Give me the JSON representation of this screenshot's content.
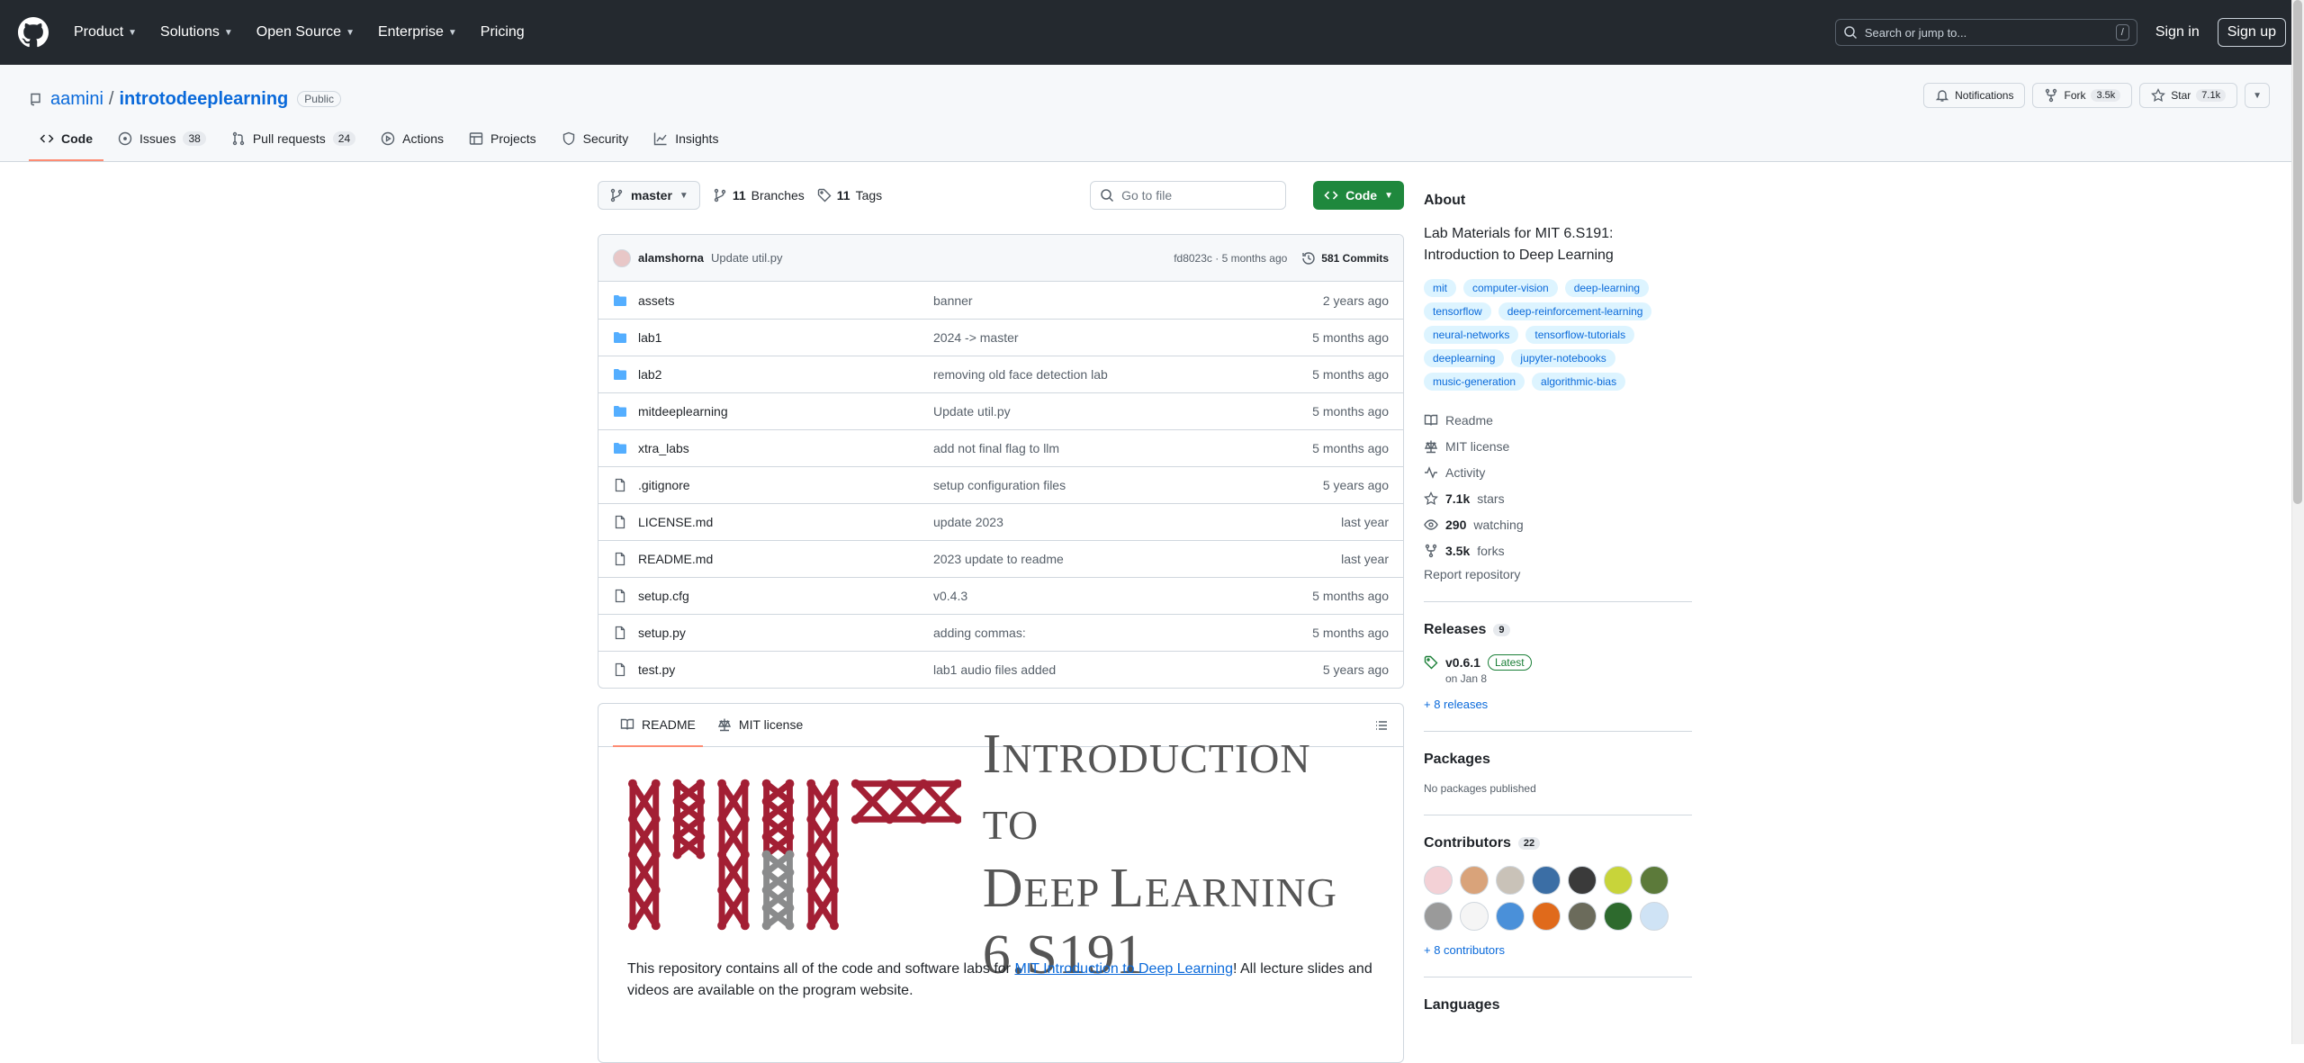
{
  "nav": {
    "menu": [
      "Product",
      "Solutions",
      "Open Source",
      "Enterprise",
      "Pricing"
    ],
    "search_placeholder": "Search or jump to...",
    "search_key": "/",
    "signin": "Sign in",
    "signup": "Sign up"
  },
  "repo": {
    "owner": "aamini",
    "sep": "/",
    "name": "introtodeeplearning",
    "visibility": "Public",
    "actions": {
      "notifications": "Notifications",
      "fork": "Fork",
      "fork_count": "3.5k",
      "star": "Star",
      "star_count": "7.1k"
    },
    "tabs": [
      {
        "label": "Code",
        "count": ""
      },
      {
        "label": "Issues",
        "count": "38"
      },
      {
        "label": "Pull requests",
        "count": "24"
      },
      {
        "label": "Actions",
        "count": ""
      },
      {
        "label": "Projects",
        "count": ""
      },
      {
        "label": "Security",
        "count": ""
      },
      {
        "label": "Insights",
        "count": ""
      }
    ]
  },
  "branchbar": {
    "branch": "master",
    "branches_count": "11",
    "branches_label": "Branches",
    "tags_count": "11",
    "tags_label": "Tags",
    "goto_placeholder": "Go to file",
    "code_label": "Code"
  },
  "commit": {
    "author": "alamshorna",
    "message": "Update util.py",
    "hash_age": "fd8023c · 5 months ago",
    "commits": "581 Commits"
  },
  "files": [
    {
      "name": "assets",
      "type": "dir",
      "message": "banner",
      "age": "2 years ago"
    },
    {
      "name": "lab1",
      "type": "dir",
      "message": "2024 -> master",
      "age": "5 months ago"
    },
    {
      "name": "lab2",
      "type": "dir",
      "message": "removing old face detection lab",
      "age": "5 months ago"
    },
    {
      "name": "mitdeeplearning",
      "type": "dir",
      "message": "Update util.py",
      "age": "5 months ago"
    },
    {
      "name": "xtra_labs",
      "type": "dir",
      "message": "add not final flag to llm",
      "age": "5 months ago"
    },
    {
      "name": ".gitignore",
      "type": "file",
      "message": "setup configuration files",
      "age": "5 years ago"
    },
    {
      "name": "LICENSE.md",
      "type": "file",
      "message": "update 2023",
      "age": "last year"
    },
    {
      "name": "README.md",
      "type": "file",
      "message": "2023 update to readme",
      "age": "last year"
    },
    {
      "name": "setup.cfg",
      "type": "file",
      "message": "v0.4.3",
      "age": "5 months ago"
    },
    {
      "name": "setup.py",
      "type": "file",
      "message": "adding commas:",
      "age": "5 months ago"
    },
    {
      "name": "test.py",
      "type": "file",
      "message": "lab1 audio files added",
      "age": "5 years ago"
    }
  ],
  "readme": {
    "tab_readme": "README",
    "tab_license": "MIT license",
    "banner_line1_big": "I",
    "banner_line1_small": "NTRODUCTION TO",
    "banner_line2_big1": "D",
    "banner_line2_small1": "EEP ",
    "banner_line2_big2": "L",
    "banner_line2_small2": "EARNING",
    "banner_line3": "6.S191",
    "intro_before": "This repository contains all of the code and software labs for ",
    "intro_link": "MIT Introduction to Deep Learning",
    "intro_after": "! All lecture slides and videos are available on the program website."
  },
  "about": {
    "title": "About",
    "description": "Lab Materials for MIT 6.S191: Introduction to Deep Learning",
    "topics": [
      "mit",
      "computer-vision",
      "deep-learning",
      "tensorflow",
      "deep-reinforcement-learning",
      "neural-networks",
      "tensorflow-tutorials",
      "deeplearning",
      "jupyter-notebooks",
      "music-generation",
      "algorithmic-bias"
    ],
    "readme": "Readme",
    "license": "MIT license",
    "activity": "Activity",
    "stars_value": "7.1k",
    "stars_label": "stars",
    "watching_value": "290",
    "watching_label": "watching",
    "forks_value": "3.5k",
    "forks_label": "forks",
    "report": "Report repository"
  },
  "releases": {
    "title": "Releases",
    "count": "9",
    "version": "v0.6.1",
    "badge": "Latest",
    "date": "on Jan 8",
    "more": "+ 8 releases"
  },
  "packages": {
    "title": "Packages",
    "empty": "No packages published"
  },
  "contributors": {
    "title": "Contributors",
    "count": "22",
    "more": "+ 8 contributors",
    "avatar_colors": [
      "#f3d1d6",
      "#d9a37a",
      "#c9c2b8",
      "#3b6ea5",
      "#3a3a3a",
      "#c8d43a",
      "#5c7a3a",
      "#9a9a9a",
      "#f5f5f5",
      "#4a90d9",
      "#e06a1b",
      "#6b6b5b",
      "#2d6a2d",
      "#cfe3f5"
    ]
  },
  "languages": {
    "title": "Languages"
  },
  "colors": {
    "header_bg": "#24292f",
    "link": "#0969da",
    "green": "#1f883d",
    "mit_red": "#a31f34",
    "mit_gray": "#8a8b8c"
  }
}
